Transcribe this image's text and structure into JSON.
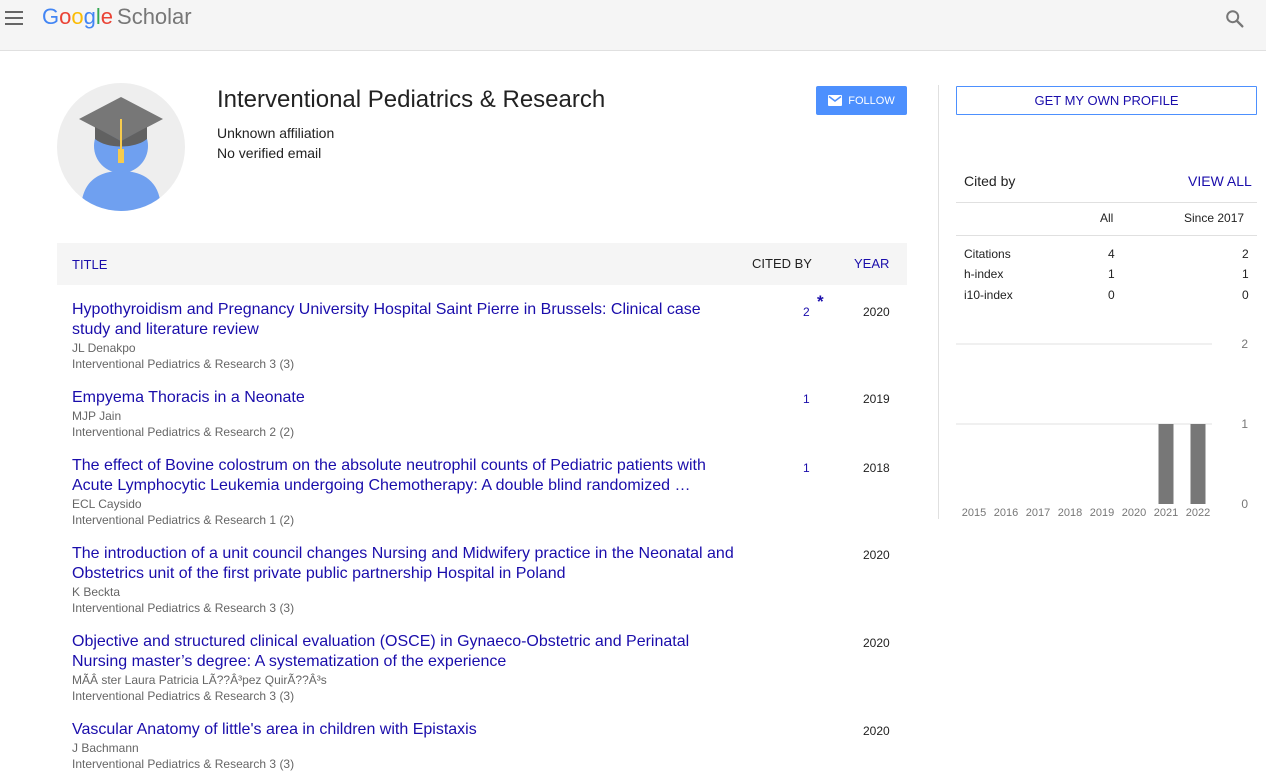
{
  "header": {
    "logo_letters": [
      "G",
      "o",
      "o",
      "g",
      "l",
      "e"
    ],
    "logo_scholar": "Scholar"
  },
  "profile": {
    "name": "Interventional Pediatrics & Research",
    "affiliation": "Unknown affiliation",
    "email": "No verified email",
    "follow_label": "FOLLOW"
  },
  "table": {
    "col_title": "TITLE",
    "col_cited": "CITED BY",
    "col_year": "YEAR",
    "rows": [
      {
        "title": "Hypothyroidism and Pregnancy University Hospital Saint Pierre in Brussels: Clinical case study and literature review",
        "authors": "JL Denakpo",
        "venue": "Interventional Pediatrics & Research 3 (3)",
        "cited": "2",
        "star": "*",
        "year": "2020"
      },
      {
        "title": "Empyema Thoracis in a Neonate",
        "authors": "MJP Jain",
        "venue": "Interventional Pediatrics & Research 2 (2)",
        "cited": "1",
        "year": "2019"
      },
      {
        "title": "The effect of Bovine colostrum on the absolute neutrophil counts of Pediatric patients with Acute Lymphocytic Leukemia undergoing Chemotherapy: A double blind randomized …",
        "authors": "ECL Caysido",
        "venue": "Interventional Pediatrics & Research 1 (2)",
        "cited": "1",
        "year": "2018"
      },
      {
        "title": "The introduction of a unit council changes Nursing and Midwifery practice in the Neonatal and Obstetrics unit of the first private public partnership Hospital in Poland",
        "authors": "K Beckta",
        "venue": "Interventional Pediatrics & Research 3 (3)",
        "cited": "",
        "year": "2020"
      },
      {
        "title": "Objective and structured clinical evaluation (OSCE) in Gynaeco-Obstetric and Perinatal Nursing master’s degree: A systematization of the experience",
        "authors": "MÃÂ ster Laura Patricia LÃ??Â³pez QuirÃ??Â³s",
        "venue": "Interventional Pediatrics & Research 3 (3)",
        "cited": "",
        "year": "2020"
      },
      {
        "title": "Vascular Anatomy of little's area in children with Epistaxis",
        "authors": "J Bachmann",
        "venue": "Interventional Pediatrics & Research 3 (3)",
        "cited": "",
        "year": "2020"
      }
    ]
  },
  "sidebar": {
    "own_profile_label": "GET MY OWN PROFILE",
    "cited_by_label": "Cited by",
    "view_all_label": "VIEW ALL",
    "col_all": "All",
    "col_since": "Since 2017",
    "stats": [
      {
        "label": "Citations",
        "all": "4",
        "since": "2"
      },
      {
        "label": "h-index",
        "all": "1",
        "since": "1"
      },
      {
        "label": "i10-index",
        "all": "0",
        "since": "0"
      }
    ]
  },
  "chart_data": {
    "type": "bar",
    "categories": [
      "2015",
      "2016",
      "2017",
      "2018",
      "2019",
      "2020",
      "2021",
      "2022"
    ],
    "values": [
      0,
      0,
      0,
      0,
      0,
      0,
      1,
      1
    ],
    "y_ticks": [
      "2",
      "1",
      "0"
    ],
    "ylim": [
      0,
      2
    ],
    "grid": true,
    "bar_color": "#777777"
  }
}
